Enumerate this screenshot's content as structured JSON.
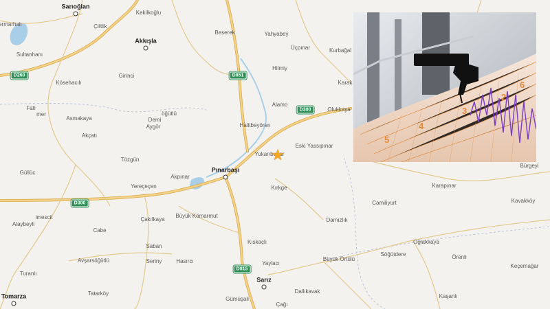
{
  "map": {
    "roads": {
      "D260": "D260",
      "D851": "D851",
      "D300_east": "D300",
      "D300_west": "D300",
      "D815": "D815"
    },
    "places": {
      "sarioglan": "Sarıoğlan",
      "kekilkoglu": "Kekilkoğlu",
      "cermarhali": "ermarhalı",
      "ciftlik": "Çiftlik",
      "akkisla": "Akkışla",
      "beserek": "Beserek",
      "yahyabey": "Yahyabeý",
      "ucpinar": "Üçpınar",
      "kurbagal": "Kurbağal",
      "sultanhani": "Sultanhanı",
      "kosehacili": "Kösehacılı",
      "girinci": "Girinci",
      "hilmiy": "Hilmiy",
      "karak": "Karak",
      "alamo": "Alamo",
      "olukkaya": "Olukkaya",
      "fati": "Fati",
      "mer": "mer",
      "sogutlu_north": "öğütlü",
      "asmakaya": "Asmakaya",
      "demi": "Demi",
      "aygor": "Aygör",
      "halitbeyoren": "Halitbeyören",
      "akcati": "Akçatı",
      "eski_yassipinar": "Eski Yassıpınar",
      "tozgun": "Tözgün",
      "yukaribuhar": "Yukarıbuhar",
      "gulluc": "Güllüc",
      "akpinar": "Akpınar",
      "pinarbasi": "Pınarbaşı",
      "karapinar": "Karapınar",
      "yerececen": "Yereçeçen",
      "kirkge": "Kırkge",
      "burgeyi": "Bürgeyi",
      "kavakkoy": "Kavakköy",
      "camiliyurt": "Camiliyurt",
      "alaybeyli": "Alaybeyli",
      "imescit": "imescit",
      "cakilkaya": "Çakılkaya",
      "buyuk_komarmut": "Büyük Kömarmut",
      "damizlik": "Damızlık",
      "cabe": "Cabe",
      "saban": "Saban",
      "kiskacli": "Kıskaçlı",
      "oglakkaya": "Oğlakkaya",
      "turanli": "Turanlı",
      "avsarsogutlu": "Avşarsöğütlü",
      "seriny": "Seriny",
      "hasirci": "Hasırcı",
      "yaylaci": "Yaylacı",
      "buyuk_ortulu": "Büyük Örtülü",
      "sogutdere": "Söğütdere",
      "orenli": "Örenli",
      "kecemagar": "Keçemağar",
      "tomarza": "Tomarza",
      "tatarkoy": "Tatarköy",
      "gumusali": "Gümüşali",
      "sariz": "Sarız",
      "dallikavak": "Dallıkavak",
      "cagi": "Çağı",
      "kasanli": "Kaşanlı"
    },
    "epicenter_icon": "star-icon",
    "colors": {
      "road": "#f3d38a",
      "road_casing": "#d9a94a",
      "water": "#a9cfe8",
      "boundary": "#b9c3d8",
      "epicenter": "#f5a623",
      "shield": "#2f8f57"
    }
  },
  "photo": {
    "subject": "seismograph-drum-icon",
    "scale_numbers": [
      "5",
      "4",
      "3",
      "2",
      "6"
    ]
  }
}
